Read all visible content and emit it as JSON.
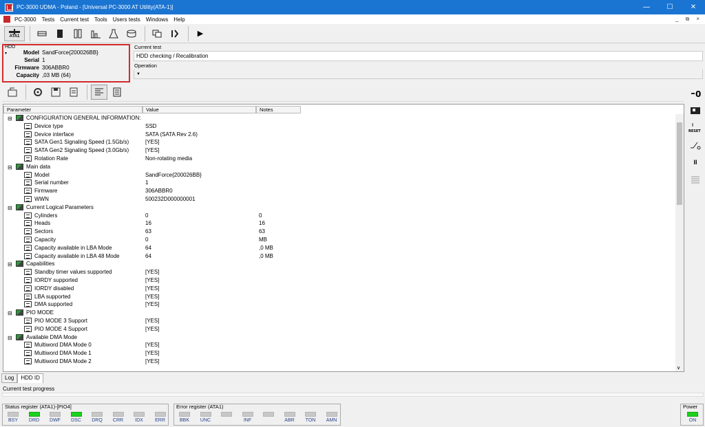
{
  "window": {
    "title": "PC-3000 UDMA - Poland - [Universal PC-3000 AT Utility(ATA-1)]"
  },
  "menu": {
    "items": [
      "PC-3000",
      "Tests",
      "Current test",
      "Tools",
      "Users tests",
      "Windows",
      "Help"
    ]
  },
  "toolbar": {
    "ata_label": "ATA1"
  },
  "hdd": {
    "label": "HDD",
    "rows": [
      {
        "k": "Model",
        "v": "SandForce{200026BB}"
      },
      {
        "k": "Serial",
        "v": "1"
      },
      {
        "k": "Firmware",
        "v": "306ABBR0"
      },
      {
        "k": "Capacity",
        "v": ",03 MB (64)"
      }
    ]
  },
  "current_test": {
    "label": "Current test",
    "value": "HDD checking / Recalibration"
  },
  "operation": {
    "label": "Operation",
    "value": ""
  },
  "grid": {
    "columns": [
      "Parameter",
      "Value",
      "Notes"
    ],
    "rows": [
      {
        "lvl": 0,
        "p": "CONFIGURATION GENERAL INFORMATION:",
        "v": "",
        "n": ""
      },
      {
        "lvl": 1,
        "p": "Device type",
        "v": "SSD",
        "n": ""
      },
      {
        "lvl": 1,
        "p": "Device interface",
        "v": "SATA (SATA Rev 2.6)",
        "n": ""
      },
      {
        "lvl": 1,
        "p": "SATA Gen1 Signaling Speed (1.5Gb/s)",
        "v": "[YES]",
        "n": ""
      },
      {
        "lvl": 1,
        "p": "SATA Gen2 Signaling Speed (3.0Gb/s)",
        "v": "[YES]",
        "n": ""
      },
      {
        "lvl": 1,
        "p": "Rotation Rate",
        "v": "Non-rotating media",
        "n": ""
      },
      {
        "lvl": 0,
        "p": "Main data",
        "v": "",
        "n": ""
      },
      {
        "lvl": 1,
        "p": "Model",
        "v": "SandForce{200026BB}",
        "n": ""
      },
      {
        "lvl": 1,
        "p": "Serial number",
        "v": "1",
        "n": ""
      },
      {
        "lvl": 1,
        "p": "Firmware",
        "v": "306ABBR0",
        "n": ""
      },
      {
        "lvl": 1,
        "p": "WWN",
        "v": "500232D000000001",
        "n": ""
      },
      {
        "lvl": 0,
        "p": "Current Logical Parameters",
        "v": "",
        "n": ""
      },
      {
        "lvl": 1,
        "p": "Cylinders",
        "v": "0",
        "n": "0"
      },
      {
        "lvl": 1,
        "p": "Heads",
        "v": "16",
        "n": "16"
      },
      {
        "lvl": 1,
        "p": "Sectors",
        "v": "63",
        "n": "63"
      },
      {
        "lvl": 1,
        "p": "Capacity",
        "v": "0",
        "n": " MB"
      },
      {
        "lvl": 1,
        "p": "Capacity available in LBA Mode",
        "v": "64",
        "n": ",0 MB"
      },
      {
        "lvl": 1,
        "p": "Capacity available in LBA 48 Mode",
        "v": "64",
        "n": ",0 MB"
      },
      {
        "lvl": 0,
        "p": "Capabilities",
        "v": "",
        "n": ""
      },
      {
        "lvl": 1,
        "p": "Standby timer values supported",
        "v": "[YES]",
        "n": ""
      },
      {
        "lvl": 1,
        "p": "IORDY supported",
        "v": "[YES]",
        "n": ""
      },
      {
        "lvl": 1,
        "p": "IORDY disabled",
        "v": "[YES]",
        "n": ""
      },
      {
        "lvl": 1,
        "p": "LBA supported",
        "v": "[YES]",
        "n": ""
      },
      {
        "lvl": 1,
        "p": "DMA supported",
        "v": "[YES]",
        "n": ""
      },
      {
        "lvl": 0,
        "p": "PIO MODE",
        "v": "",
        "n": ""
      },
      {
        "lvl": 1,
        "p": "PIO MODE 3 Support",
        "v": "[YES]",
        "n": ""
      },
      {
        "lvl": 1,
        "p": "PIO MODE 4 Support",
        "v": "[YES]",
        "n": ""
      },
      {
        "lvl": 0,
        "p": "Available DMA Mode",
        "v": "",
        "n": ""
      },
      {
        "lvl": 1,
        "p": "Multiword DMA Mode 0",
        "v": "[YES]",
        "n": ""
      },
      {
        "lvl": 1,
        "p": "Multiword DMA Mode 1",
        "v": "[YES]",
        "n": ""
      },
      {
        "lvl": 1,
        "p": "Multiword DMA Mode 2",
        "v": "[YES]",
        "n": ""
      }
    ]
  },
  "tabs": [
    "Log",
    "HDD ID"
  ],
  "progress": {
    "label": "Current test progress"
  },
  "status_register": {
    "label": "Status register (ATA1)-[PIO4]",
    "leds": [
      {
        "name": "BSY",
        "on": false
      },
      {
        "name": "DRD",
        "on": true
      },
      {
        "name": "DWF",
        "on": false
      },
      {
        "name": "DSC",
        "on": true
      },
      {
        "name": "DRQ",
        "on": false
      },
      {
        "name": "CRR",
        "on": false
      },
      {
        "name": "IDX",
        "on": false
      },
      {
        "name": "ERR",
        "on": false
      }
    ]
  },
  "error_register": {
    "label": "Error register (ATA1)",
    "leds": [
      {
        "name": "BBK",
        "on": false
      },
      {
        "name": "UNC",
        "on": false
      },
      {
        "name": "",
        "on": false
      },
      {
        "name": "INF",
        "on": false
      },
      {
        "name": "",
        "on": false
      },
      {
        "name": "ABR",
        "on": false
      },
      {
        "name": "TON",
        "on": false
      },
      {
        "name": "AMN",
        "on": false
      }
    ]
  },
  "power": {
    "label": "Power",
    "led": "ON",
    "on": true
  },
  "colors": {
    "titlebar": "#1a74d2",
    "highlight_border": "#d42a2a",
    "led_on": "#1bd21b"
  }
}
